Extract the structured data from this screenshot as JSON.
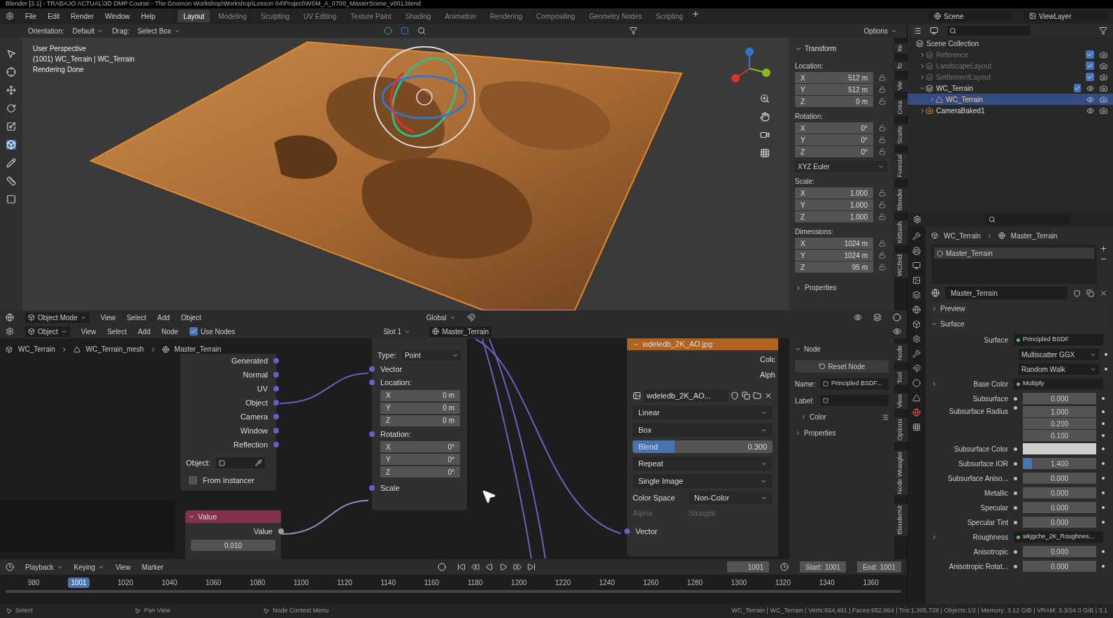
{
  "title_bar": {
    "title": "Blender [3.1] - TRABAJO ACTUAL\\3D DMP Course - The Gnomon Workshop\\Workshop\\Lesson 04\\Project\\WSM_A_0700_MasterScene_v001.blend"
  },
  "menus": [
    "File",
    "Edit",
    "Render",
    "Window",
    "Help"
  ],
  "workspaces": [
    {
      "label": "Layout",
      "selected": true
    },
    {
      "label": "Modeling",
      "selected": false
    },
    {
      "label": "Sculpting",
      "selected": false
    },
    {
      "label": "UV Editing",
      "selected": false
    },
    {
      "label": "Texture Paint",
      "selected": false
    },
    {
      "label": "Shading",
      "selected": false
    },
    {
      "label": "Animation",
      "selected": false
    },
    {
      "label": "Rendering",
      "selected": false
    },
    {
      "label": "Compositing",
      "selected": false
    },
    {
      "label": "Geometry Nodes",
      "selected": false
    },
    {
      "label": "Scripting",
      "selected": false
    }
  ],
  "scene": "Scene",
  "view_layer": "ViewLayer",
  "viewport": {
    "orientation_label": "Orientation:",
    "orientation": "Default",
    "drag_label": "Drag:",
    "drag": "Select Box",
    "options": "Options",
    "overlay": [
      "User Perspective",
      "(1001) WC_Terrain | WC_Terrain",
      "Rendering Done"
    ],
    "mode": "Object Mode",
    "menus": [
      "View",
      "Select",
      "Add",
      "Object"
    ],
    "transform_orientation": "Global",
    "sidebar_tabs": [
      "Ite",
      "To",
      "Vie",
      "Crea",
      "Scatte",
      "Forestal",
      "Blender",
      "KitBash",
      "WCBrid"
    ],
    "transform": {
      "title": "Transform",
      "expanded": true,
      "groups": [
        {
          "label": "Location:",
          "fields": [
            {
              "axis": "X",
              "value": "512 m"
            },
            {
              "axis": "Y",
              "value": "512 m"
            },
            {
              "axis": "Z",
              "value": "0 m"
            }
          ]
        },
        {
          "label": "Rotation:",
          "fields": [
            {
              "axis": "X",
              "value": "0°"
            },
            {
              "axis": "Y",
              "value": "0°"
            },
            {
              "axis": "Z",
              "value": "0°"
            }
          ],
          "mode": "XYZ Euler"
        },
        {
          "label": "Scale:",
          "fields": [
            {
              "axis": "X",
              "value": "1.000"
            },
            {
              "axis": "Y",
              "value": "1.000"
            },
            {
              "axis": "Z",
              "value": "1.000"
            }
          ]
        },
        {
          "label": "Dimensions:",
          "fields": [
            {
              "axis": "X",
              "value": "1024 m"
            },
            {
              "axis": "Y",
              "value": "1024 m"
            },
            {
              "axis": "Z",
              "value": "95 m"
            }
          ]
        }
      ]
    },
    "properties": {
      "label": "Properties",
      "expanded": false
    }
  },
  "outliner": {
    "root": "Scene Collection",
    "items": [
      {
        "label": "Reference",
        "kind": "collection",
        "checked": true,
        "hidden": true,
        "selected": false
      },
      {
        "label": "LandscapeLayout",
        "kind": "collection",
        "checked": true,
        "hidden": true,
        "selected": false
      },
      {
        "label": "SettlementLayout",
        "kind": "collection",
        "checked": true,
        "hidden": true,
        "selected": false
      },
      {
        "label": "WC_Terrain",
        "kind": "collection",
        "checked": true,
        "hidden": false,
        "selected": false,
        "children": [
          {
            "label": "WC_Terrain",
            "kind": "mesh",
            "hidden": false,
            "selected": true
          }
        ]
      },
      {
        "label": "CameraBaked1",
        "kind": "camera",
        "hidden": false,
        "selected": false
      }
    ]
  },
  "node_editor": {
    "editor": "Object",
    "menus": [
      "View",
      "Select",
      "Add",
      "Node"
    ],
    "use_nodes": {
      "label": "Use Nodes",
      "checked": true
    },
    "slot": "Slot 1",
    "material": "Master_Terrain",
    "breadcrumb": [
      "WC_Terrain",
      "WC_Terrain_mesh",
      "Master_Terrain"
    ],
    "texture_coordinate_node": {
      "outputs": [
        "Generated",
        "Normal",
        "UV",
        "Object",
        "Camera",
        "Window",
        "Reflection"
      ],
      "object_label": "Object:",
      "from_instancer": {
        "label": "From Instancer",
        "checked": false
      }
    },
    "value_node": {
      "title": "Value",
      "output": "Value",
      "value": "0.010"
    },
    "mapping_node": {
      "type_label": "Type:",
      "type": "Point",
      "vector": "Vector",
      "groups": [
        {
          "label": "Location:",
          "fields": [
            {
              "axis": "X",
              "value": "0 m"
            },
            {
              "axis": "Y",
              "value": "0 m"
            },
            {
              "axis": "Z",
              "value": "0 m"
            }
          ]
        },
        {
          "label": "Rotation:",
          "fields": [
            {
              "axis": "X",
              "value": "0°"
            },
            {
              "axis": "Y",
              "value": "0°"
            },
            {
              "axis": "Z",
              "value": "0°"
            }
          ]
        }
      ],
      "scale": "Scale"
    },
    "image_node": {
      "title": "wdeledb_2K_AO.jpg",
      "outputs": [
        "Colc",
        "Alph"
      ],
      "image": "wdeledb_2K_AO...",
      "options": [
        "Linear",
        "Box"
      ],
      "blend": {
        "label": "Blend",
        "value": "0.300",
        "level": 0.3
      },
      "options2": [
        "Repeat",
        "Single Image"
      ],
      "color_space_label": "Color Space",
      "color_space": "Non-Color",
      "alpha_label": "Alpha",
      "alpha": "Straight",
      "alpha_disabled": true,
      "vector": "Vector"
    },
    "sidebar": {
      "panel": "Node",
      "reset": "Reset Node",
      "name_label": "Name:",
      "name": "Principled BSDF...",
      "label_label": "Label:",
      "color": {
        "label": "Color",
        "expanded": false
      },
      "properties": {
        "label": "Properties",
        "expanded": false
      },
      "tabs": [
        "Node",
        "Tool",
        "View",
        "Options",
        "Node Wrangler",
        "BlenderKit"
      ]
    }
  },
  "properties_editor": {
    "breadcrumb": [
      "WC_Terrain",
      "Master_Terrain"
    ],
    "slot": "Master_Terrain",
    "material": "Master_Terrain",
    "panels": [
      {
        "label": "Preview",
        "expanded": false
      },
      {
        "label": "Surface",
        "expanded": true
      }
    ],
    "rows": [
      {
        "kind": "link",
        "label": "Surface",
        "value": "Principled BSDF",
        "expandable": false
      },
      {
        "kind": "dropdown",
        "value": "Multiscatter GGX"
      },
      {
        "kind": "dropdown",
        "value": "Random Walk"
      },
      {
        "kind": "link",
        "label": "Base Color",
        "value": "Multiply",
        "expandable": true
      },
      {
        "kind": "number",
        "label": "Subsurface",
        "value": "0.000"
      },
      {
        "kind": "vector",
        "label": "Subsurface Radius",
        "values": [
          "1.000",
          "0.200",
          "0.100"
        ]
      },
      {
        "kind": "color",
        "label": "Subsurface Color"
      },
      {
        "kind": "slider",
        "label": "Subsurface IOR",
        "value": "1.400",
        "level": 0.12
      },
      {
        "kind": "number",
        "label": "Subsurface Aniso...",
        "value": "0.000"
      },
      {
        "kind": "number",
        "label": "Metallic",
        "value": "0.000"
      },
      {
        "kind": "number",
        "label": "Specular",
        "value": "0.000"
      },
      {
        "kind": "number",
        "label": "Specular Tint",
        "value": "0.000"
      },
      {
        "kind": "link",
        "label": "Roughness",
        "value": "wkjgche_2K_Roughnes...",
        "expandable": true
      },
      {
        "kind": "number",
        "label": "Anisotropic",
        "value": "0.000"
      },
      {
        "kind": "number",
        "label": "Anisotropic Rotat...",
        "value": "0.000"
      }
    ]
  },
  "timeline": {
    "menus": [
      "Playback",
      "Keying",
      "View",
      "Marker"
    ],
    "frame": "1001",
    "start_label": "Start:",
    "start": "1001",
    "end_label": "End:",
    "end": "1001",
    "ticks": [
      {
        "label": "980",
        "selected": false
      },
      {
        "label": "1001",
        "selected": true
      },
      {
        "label": "1020",
        "selected": false
      },
      {
        "label": "1040",
        "selected": false
      },
      {
        "label": "1060",
        "selected": false
      },
      {
        "label": "1080",
        "selected": false
      },
      {
        "label": "1100",
        "selected": false
      },
      {
        "label": "1120",
        "selected": false
      },
      {
        "label": "1140",
        "selected": false
      },
      {
        "label": "1160",
        "selected": false
      },
      {
        "label": "1180",
        "selected": false
      },
      {
        "label": "1200",
        "selected": false
      },
      {
        "label": "1220",
        "selected": false
      },
      {
        "label": "1240",
        "selected": false
      },
      {
        "label": "1260",
        "selected": false
      },
      {
        "label": "1280",
        "selected": false
      },
      {
        "label": "1300",
        "selected": false
      },
      {
        "label": "1320",
        "selected": false
      },
      {
        "label": "1340",
        "selected": false
      },
      {
        "label": "1360",
        "selected": false
      }
    ]
  },
  "status_bar": {
    "hints": [
      "Select",
      "Pan View",
      "Node Context Menu"
    ],
    "stats": "WC_Terrain | WC_Terrain | Verts:654,481 | Faces:652,864 | Tris:1,305,728 | Objects:1/2 | Memory: 3.12 GiB | VRAM: 3.3/24.0 GiB | 3.1"
  }
}
